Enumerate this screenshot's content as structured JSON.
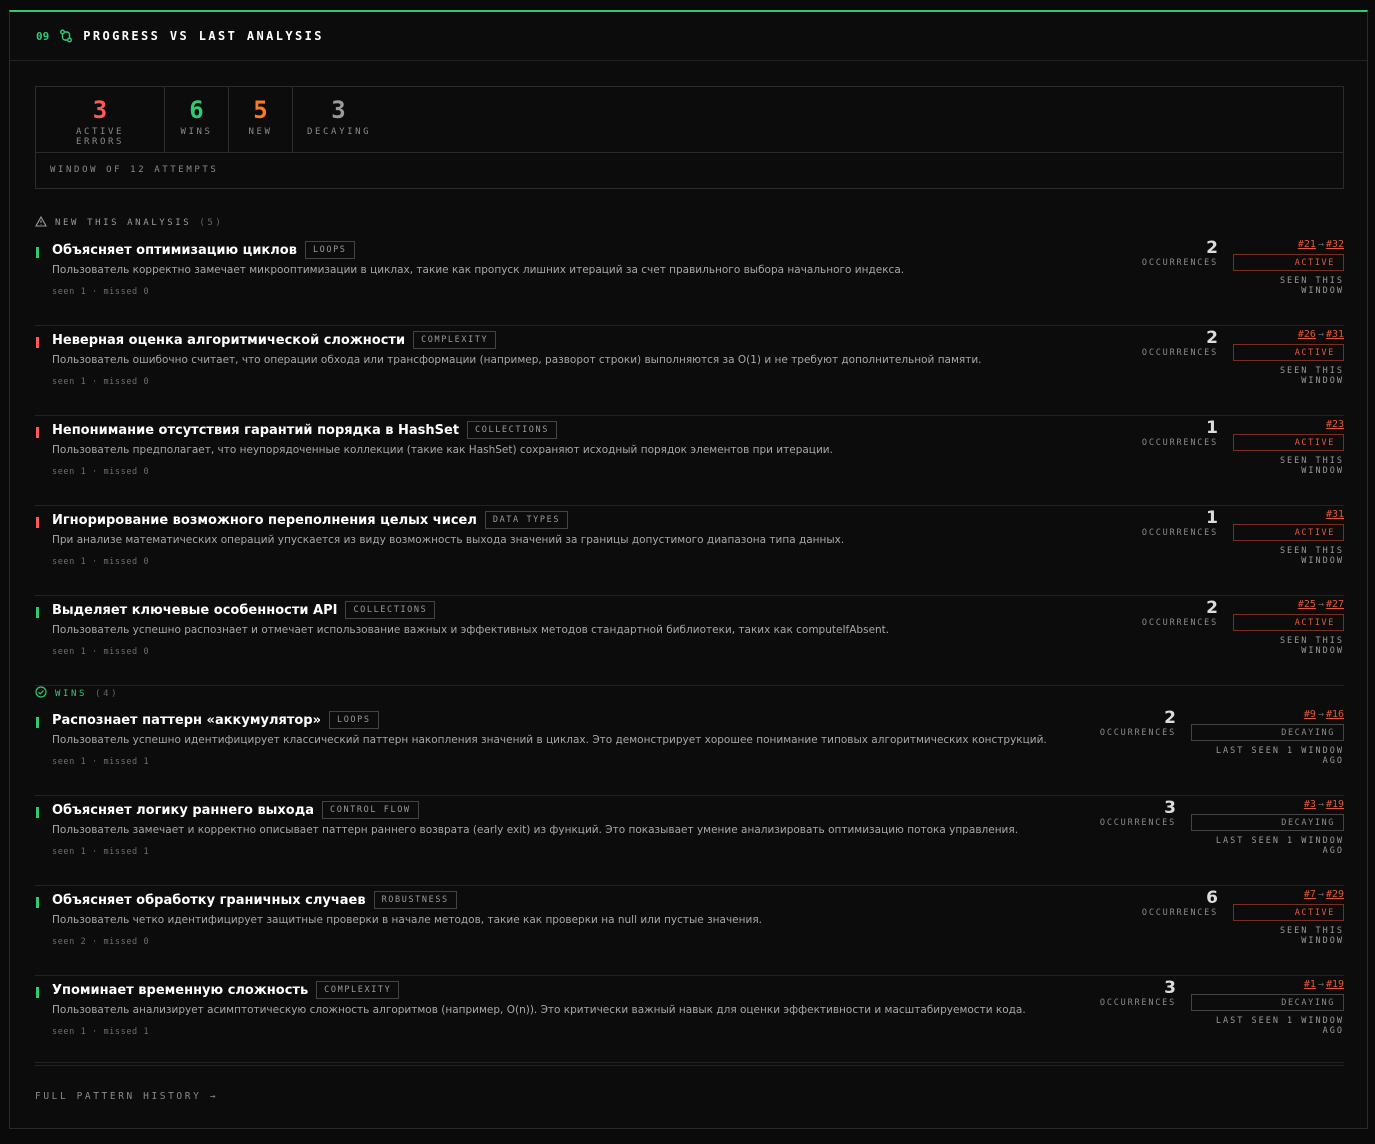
{
  "header": {
    "number": "09",
    "title": "PROGRESS VS LAST ANALYSIS"
  },
  "summary": {
    "stats": [
      {
        "value": "3",
        "label": "ACTIVE ERRORS",
        "color": "#ff5a5a"
      },
      {
        "value": "6",
        "label": "WINS",
        "color": "#2ecc71"
      },
      {
        "value": "5",
        "label": "NEW",
        "color": "#ff7a1a"
      },
      {
        "value": "3",
        "label": "DECAYING",
        "color": "#9a9a9a"
      }
    ],
    "window": "WINDOW OF 12 ATTEMPTS"
  },
  "sections": {
    "new": {
      "label": "NEW THIS ANALYSIS",
      "count": "(5)",
      "color": "#9a9a9a",
      "icon": "warning-triangle-icon"
    },
    "wins": {
      "label": "WINS",
      "count": "(4)",
      "color": "#2ecc71",
      "icon": "check-circle-icon"
    }
  },
  "colors": {
    "win": "#2ecc71",
    "error": "#ff5a5a",
    "accent": "#e05a3a"
  },
  "new_items": [
    {
      "kind": "win",
      "title": "Объясняет оптимизацию циклов",
      "tag": "LOOPS",
      "desc": "Пользователь корректно замечает микрооптимизации в циклах, такие как пропуск лишних итераций за счет правильного выбора начального индекса.",
      "meta": "seen 1 · missed 0",
      "occurrences": "2",
      "occ_label": "OCCURRENCES",
      "from": "#21",
      "to": "#32",
      "status": "ACTIVE",
      "seen": "SEEN THIS WINDOW"
    },
    {
      "kind": "error",
      "title": "Неверная оценка алгоритмической сложности",
      "tag": "COMPLEXITY",
      "desc": "Пользователь ошибочно считает, что операции обхода или трансформации (например, разворот строки) выполняются за O(1) и не требуют дополнительной памяти.",
      "meta": "seen 1 · missed 0",
      "occurrences": "2",
      "occ_label": "OCCURRENCES",
      "from": "#26",
      "to": "#31",
      "status": "ACTIVE",
      "seen": "SEEN THIS WINDOW"
    },
    {
      "kind": "error",
      "title": "Непонимание отсутствия гарантий порядка в HashSet",
      "tag": "COLLECTIONS",
      "desc": "Пользователь предполагает, что неупорядоченные коллекции (такие как HashSet) сохраняют исходный порядок элементов при итерации.",
      "meta": "seen 1 · missed 0",
      "occurrences": "1",
      "occ_label": "OCCURRENCES",
      "from": "",
      "to": "#23",
      "status": "ACTIVE",
      "seen": "SEEN THIS WINDOW"
    },
    {
      "kind": "error",
      "title": "Игнорирование возможного переполнения целых чисел",
      "tag": "DATA TYPES",
      "desc": "При анализе математических операций упускается из виду возможность выхода значений за границы допустимого диапазона типа данных.",
      "meta": "seen 1 · missed 0",
      "occurrences": "1",
      "occ_label": "OCCURRENCES",
      "from": "",
      "to": "#31",
      "status": "ACTIVE",
      "seen": "SEEN THIS WINDOW"
    },
    {
      "kind": "win",
      "title": "Выделяет ключевые особенности API",
      "tag": "COLLECTIONS",
      "desc": "Пользователь успешно распознает и отмечает использование важных и эффективных методов стандартной библиотеки, таких как computeIfAbsent.",
      "meta": "seen 1 · missed 0",
      "occurrences": "2",
      "occ_label": "OCCURRENCES",
      "from": "#25",
      "to": "#27",
      "status": "ACTIVE",
      "seen": "SEEN THIS WINDOW"
    }
  ],
  "win_items": [
    {
      "kind": "win",
      "title": "Распознает паттерн «аккумулятор»",
      "tag": "LOOPS",
      "desc": "Пользователь успешно идентифицирует классический паттерн накопления значений в циклах. Это демонстрирует хорошее понимание типовых алгоритмических конструкций.",
      "meta": "seen 1 · missed 1",
      "occurrences": "2",
      "occ_label": "OCCURRENCES",
      "from": "#9",
      "to": "#16",
      "status": "DECAYING",
      "seen": "LAST SEEN 1 WINDOW AGO"
    },
    {
      "kind": "win",
      "title": "Объясняет логику раннего выхода",
      "tag": "CONTROL FLOW",
      "desc": "Пользователь замечает и корректно описывает паттерн раннего возврата (early exit) из функций. Это показывает умение анализировать оптимизацию потока управления.",
      "meta": "seen 1 · missed 1",
      "occurrences": "3",
      "occ_label": "OCCURRENCES",
      "from": "#3",
      "to": "#19",
      "status": "DECAYING",
      "seen": "LAST SEEN 1 WINDOW AGO"
    },
    {
      "kind": "win",
      "title": "Объясняет обработку граничных случаев",
      "tag": "ROBUSTNESS",
      "desc": "Пользователь четко идентифицирует защитные проверки в начале методов, такие как проверки на null или пустые значения.",
      "meta": "seen 2 · missed 0",
      "occurrences": "6",
      "occ_label": "OCCURRENCES",
      "from": "#7",
      "to": "#29",
      "status": "ACTIVE",
      "seen": "SEEN THIS WINDOW"
    },
    {
      "kind": "win",
      "title": "Упоминает временную сложность",
      "tag": "COMPLEXITY",
      "desc": "Пользователь анализирует асимптотическую сложность алгоритмов (например, O(n)). Это критически важный навык для оценки эффективности и масштабируемости кода.",
      "meta": "seen 1 · missed 1",
      "occurrences": "3",
      "occ_label": "OCCURRENCES",
      "from": "#1",
      "to": "#19",
      "status": "DECAYING",
      "seen": "LAST SEEN 1 WINDOW AGO"
    }
  ],
  "footer": {
    "link": "FULL PATTERN HISTORY →"
  }
}
